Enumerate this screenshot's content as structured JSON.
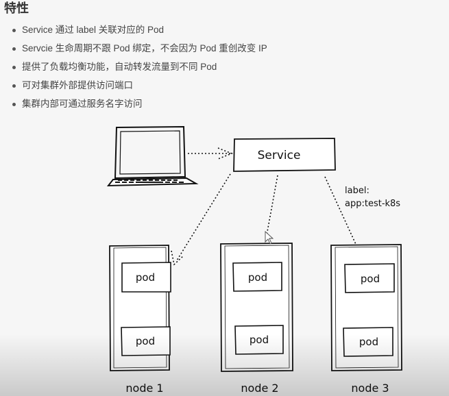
{
  "heading": "特性",
  "features": [
    "Service 通过 label 关联对应的 Pod",
    "Servcie 生命周期不跟 Pod 绑定，不会因为 Pod 重创改变 IP",
    "提供了负载均衡功能，自动转发流量到不同 Pod",
    "可对集群外部提供访问端口",
    "集群内部可通过服务名字访问"
  ],
  "diagram": {
    "service_label": "Service",
    "label_annotation_line1": "label:",
    "label_annotation_line2": "app:test-k8s",
    "pod_label": "pod",
    "nodes": [
      "node 1",
      "node 2",
      "node 3"
    ]
  },
  "icons": [
    "laptop-icon",
    "cursor-icon"
  ]
}
